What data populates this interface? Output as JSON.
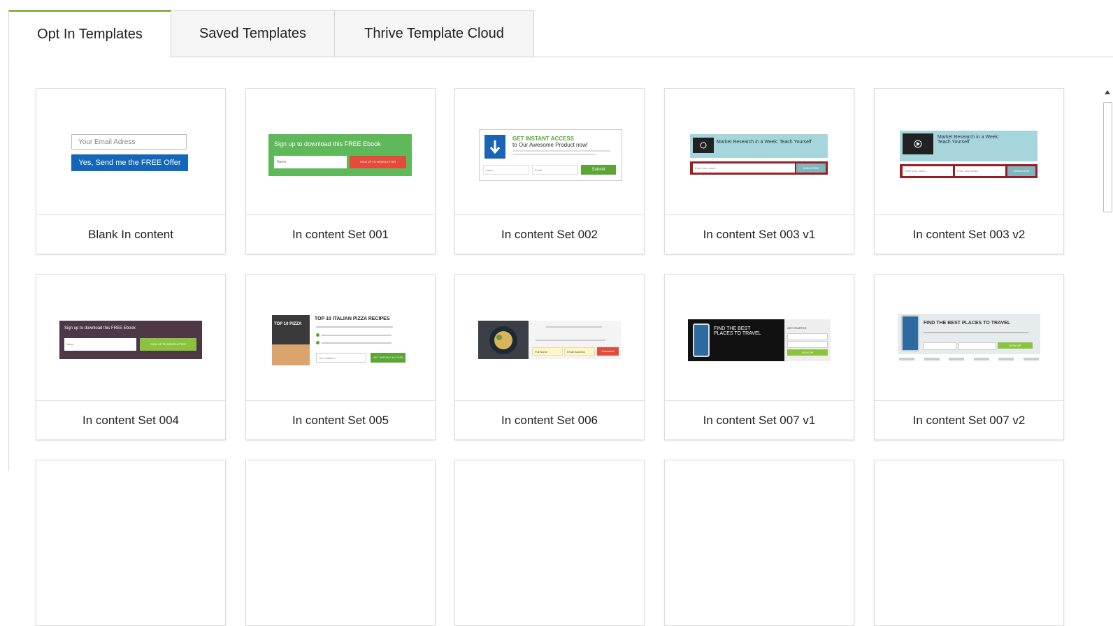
{
  "tabs": [
    {
      "label": "Opt In Templates",
      "active": true
    },
    {
      "label": "Saved Templates",
      "active": false
    },
    {
      "label": "Thrive Template Cloud",
      "active": false
    }
  ],
  "colors": {
    "accent": "#8ab34a",
    "border": "#d6d6d6"
  },
  "templates": [
    {
      "name": "Blank In content",
      "preview": {
        "input_placeholder": "Your Email Adress",
        "button": "Yes, Send me the FREE Offer"
      }
    },
    {
      "name": "In content Set 001",
      "preview": {
        "heading": "Sign up to download this FREE Ebook",
        "input": "Name",
        "button": "SIGN UP TO NEWSLETTER"
      }
    },
    {
      "name": "In content Set 002",
      "preview": {
        "heading": "GET INSTANT ACCESS",
        "subheading": "to Our Awesome Product now!",
        "field1": "Name",
        "field2": "Email",
        "button": "Submit"
      }
    },
    {
      "name": "In content Set 003 v1",
      "preview": {
        "heading": "Market Research in a Week: Teach Yourself",
        "input": "Enter your email...",
        "button": "SUBSCRIBE"
      }
    },
    {
      "name": "In content Set 003 v2",
      "preview": {
        "heading": "Market Research in a Week: Teach Yourself",
        "field1": "Enter your name...",
        "field2": "Enter your email...",
        "button": "SUBSCRIBE"
      }
    },
    {
      "name": "In content Set 004",
      "preview": {
        "heading": "Sign up to download this FREE Ebook",
        "input": "Name",
        "button": "SIGN UP TO NEWSLETTER"
      }
    },
    {
      "name": "In content Set 005",
      "preview": {
        "book": "TOP 10 PIZZA",
        "heading": "TOP 10 ITALIAN PIZZA RECIPES",
        "input": "Your Address",
        "button": "GET INSTANT ACCESS"
      }
    },
    {
      "name": "In content Set 006",
      "preview": {
        "field1": "Full Name",
        "field2": "Email Address",
        "button": "Download"
      }
    },
    {
      "name": "In content Set 007 v1",
      "preview": {
        "heading": "FIND THE BEST PLACES TO TRAVEL",
        "side": "GET STARTED",
        "button": "SIGN UP"
      }
    },
    {
      "name": "In content Set 007 v2",
      "preview": {
        "heading": "FIND THE BEST PLACES TO TRAVEL",
        "button": "SIGN UP"
      }
    }
  ]
}
